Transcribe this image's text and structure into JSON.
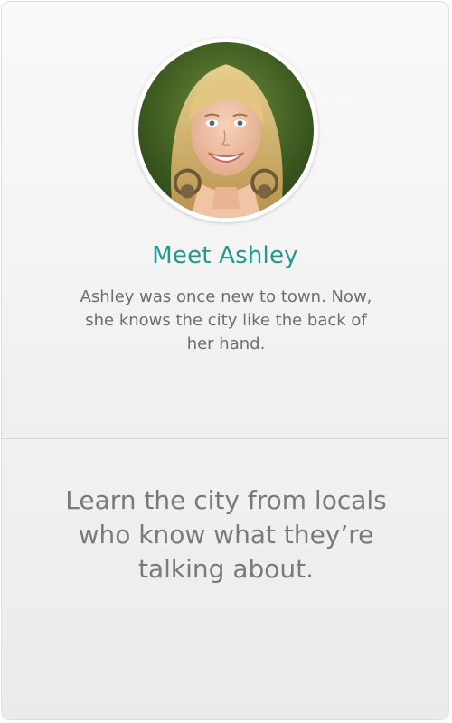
{
  "profile": {
    "name_heading": "Meet Ashley",
    "bio": "Ashley was once new to town. Now, she knows the city like the back of her hand.",
    "avatar_icon": "profile-photo"
  },
  "tagline": {
    "text": "Learn the city from locals who know what they’re talking about."
  },
  "colors": {
    "accent": "#1f9a8c",
    "body_text": "#6e6e6e",
    "tagline_text": "#7a7a7a",
    "card_border": "#dedede"
  }
}
